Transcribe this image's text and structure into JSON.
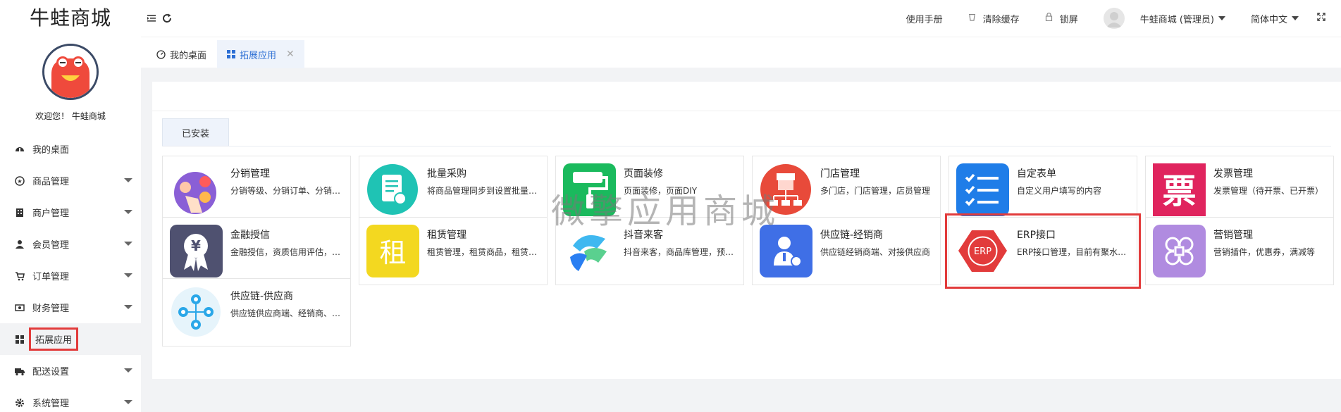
{
  "brand": "牛蛙商城",
  "welcome": "欢迎您！ 牛蛙商城",
  "nav": [
    {
      "label": "我的桌面",
      "icon": "dashboard-icon"
    },
    {
      "label": "商品管理",
      "icon": "goods-icon"
    },
    {
      "label": "商户管理",
      "icon": "shop-icon"
    },
    {
      "label": "会员管理",
      "icon": "user-icon"
    },
    {
      "label": "订单管理",
      "icon": "cart-icon"
    },
    {
      "label": "财务管理",
      "icon": "money-icon"
    },
    {
      "label": "拓展应用",
      "icon": "grid-icon",
      "active": true
    },
    {
      "label": "配送设置",
      "icon": "truck-icon"
    },
    {
      "label": "系统管理",
      "icon": "gear-icon"
    }
  ],
  "header": {
    "manual": "使用手册",
    "clear_cache": "清除缓存",
    "lock": "锁屏",
    "user": "牛蛙商城 (管理员)",
    "language": "简体中文"
  },
  "tabs": [
    {
      "label": "我的桌面"
    },
    {
      "label": "拓展应用"
    }
  ],
  "segment": "已安装",
  "watermark": "微擎应用商城",
  "apps": [
    {
      "title": "分销管理",
      "desc": "分销等级、分销订单、分销商管理",
      "color": "#8a5fd6"
    },
    {
      "title": "批量采购",
      "desc": "将商品管理同步到设置批量采购",
      "color": "#1fc3b4"
    },
    {
      "title": "页面装修",
      "desc": "页面装修，页面DIY",
      "color": "#1aba5d"
    },
    {
      "title": "门店管理",
      "desc": "多门店，门店管理，店员管理",
      "color": "#e84a3a"
    },
    {
      "title": "自定表单",
      "desc": "自定义用户填写的内容",
      "color": "#1f7de8"
    },
    {
      "title": "发票管理",
      "desc": "发票管理（待开票、已开票）",
      "color": "#e0245e"
    },
    {
      "title": "金融授信",
      "desc": "金融授信，资质信用评估，授信额度",
      "color": "#4f5170"
    },
    {
      "title": "租赁管理",
      "desc": "租赁管理，租赁商品，租赁订单",
      "color": "#f3d820"
    },
    {
      "title": "抖音来客",
      "desc": "抖音来客，商品库管理，预约管理",
      "color": "#ffffff"
    },
    {
      "title": "供应链-经销商",
      "desc": "供应链经销商端、对接供应商",
      "color": "#3f6fe6"
    },
    {
      "title": "ERP接口",
      "desc": "ERP接口管理，目前有聚水潭接口",
      "color": "#e23b3b"
    },
    {
      "title": "营销管理",
      "desc": "营销插件，优惠券，满减等",
      "color": "#b08be0"
    },
    {
      "title": "供应链-供应商",
      "desc": "供应链供应商端、经销商、商品",
      "color": "#e6f4fb"
    }
  ]
}
